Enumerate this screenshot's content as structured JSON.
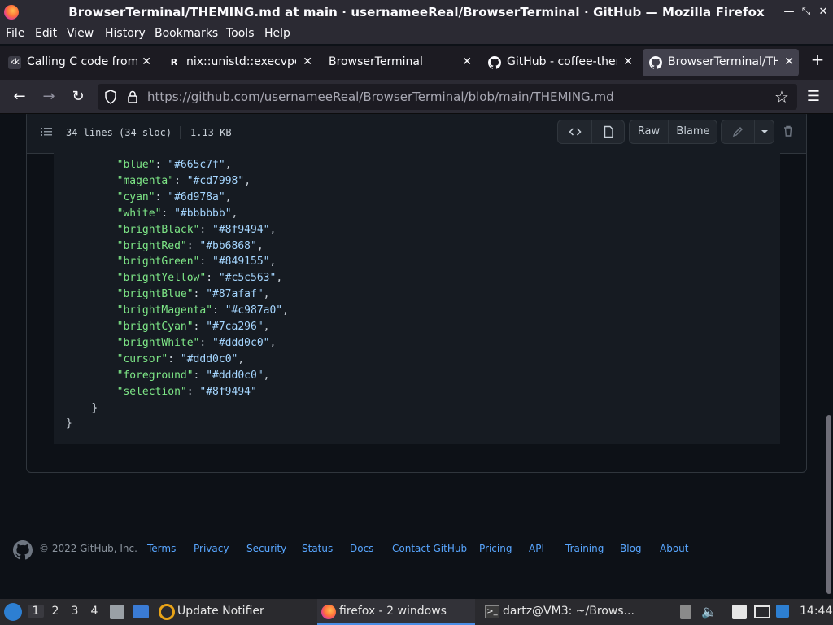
{
  "window": {
    "title": "BrowserTerminal/THEMING.md at main · usernameeReal/BrowserTerminal · GitHub — Mozilla Firefox"
  },
  "menu": [
    "File",
    "Edit",
    "View",
    "History",
    "Bookmarks",
    "Tools",
    "Help"
  ],
  "tabs": [
    {
      "icon": "kk",
      "label": "Calling C code from"
    },
    {
      "icon": "R",
      "label": "nix::unistd::execvpe"
    },
    {
      "icon": "",
      "label": "BrowserTerminal"
    },
    {
      "icon": "github-icon",
      "label": "GitHub - coffee-them"
    },
    {
      "icon": "github-icon",
      "label": "BrowserTerminal/THE"
    }
  ],
  "nav": {
    "url_host": "https://github.com",
    "url_path": "/usernameeReal/BrowserTerminal/blob/main/THEMING.md"
  },
  "file": {
    "lines": "34 lines (34 sloc)",
    "size": "1.13 KB",
    "raw": "Raw",
    "blame": "Blame"
  },
  "code": [
    {
      "indent": "        ",
      "key": "\"blue\"",
      "val": "\"#665c7f\"",
      "end": ","
    },
    {
      "indent": "        ",
      "key": "\"magenta\"",
      "val": "\"#cd7998\"",
      "end": ","
    },
    {
      "indent": "        ",
      "key": "\"cyan\"",
      "val": "\"#6d978a\"",
      "end": ","
    },
    {
      "indent": "        ",
      "key": "\"white\"",
      "val": "\"#bbbbbb\"",
      "end": ","
    },
    {
      "indent": "        ",
      "key": "\"brightBlack\"",
      "val": "\"#8f9494\"",
      "end": ","
    },
    {
      "indent": "        ",
      "key": "\"brightRed\"",
      "val": "\"#bb6868\"",
      "end": ","
    },
    {
      "indent": "        ",
      "key": "\"brightGreen\"",
      "val": "\"#849155\"",
      "end": ","
    },
    {
      "indent": "        ",
      "key": "\"brightYellow\"",
      "val": "\"#c5c563\"",
      "end": ","
    },
    {
      "indent": "        ",
      "key": "\"brightBlue\"",
      "val": "\"#87afaf\"",
      "end": ","
    },
    {
      "indent": "        ",
      "key": "\"brightMagenta\"",
      "val": "\"#c987a0\"",
      "end": ","
    },
    {
      "indent": "        ",
      "key": "\"brightCyan\"",
      "val": "\"#7ca296\"",
      "end": ","
    },
    {
      "indent": "        ",
      "key": "\"brightWhite\"",
      "val": "\"#ddd0c0\"",
      "end": ","
    },
    {
      "indent": "        ",
      "key": "\"cursor\"",
      "val": "\"#ddd0c0\"",
      "end": ","
    },
    {
      "indent": "        ",
      "key": "\"foreground\"",
      "val": "\"#ddd0c0\"",
      "end": ","
    },
    {
      "indent": "        ",
      "key": "\"selection\"",
      "val": "\"#8f9494\"",
      "end": ""
    },
    {
      "indent": "    ",
      "key": "",
      "val": "",
      "end": "}"
    },
    {
      "indent": "",
      "key": "",
      "val": "",
      "end": "}"
    }
  ],
  "footer": {
    "copyright": "© 2022 GitHub, Inc.",
    "links": [
      "Terms",
      "Privacy",
      "Security",
      "Status",
      "Docs",
      "Contact GitHub",
      "Pricing",
      "API",
      "Training",
      "Blog",
      "About"
    ]
  },
  "taskbar": {
    "workspaces": [
      "1",
      "2",
      "3",
      "4"
    ],
    "update_notifier": "Update Notifier",
    "firefox_task": "firefox - 2 windows",
    "terminal_task": "dartz@VM3: ~/Brows...",
    "clock": "14:44"
  },
  "colors": {
    "page_bg": "#0d1117",
    "code_bg": "#161b22",
    "key": "#7ee787",
    "string": "#a5d6ff",
    "link": "#58a6ff"
  }
}
